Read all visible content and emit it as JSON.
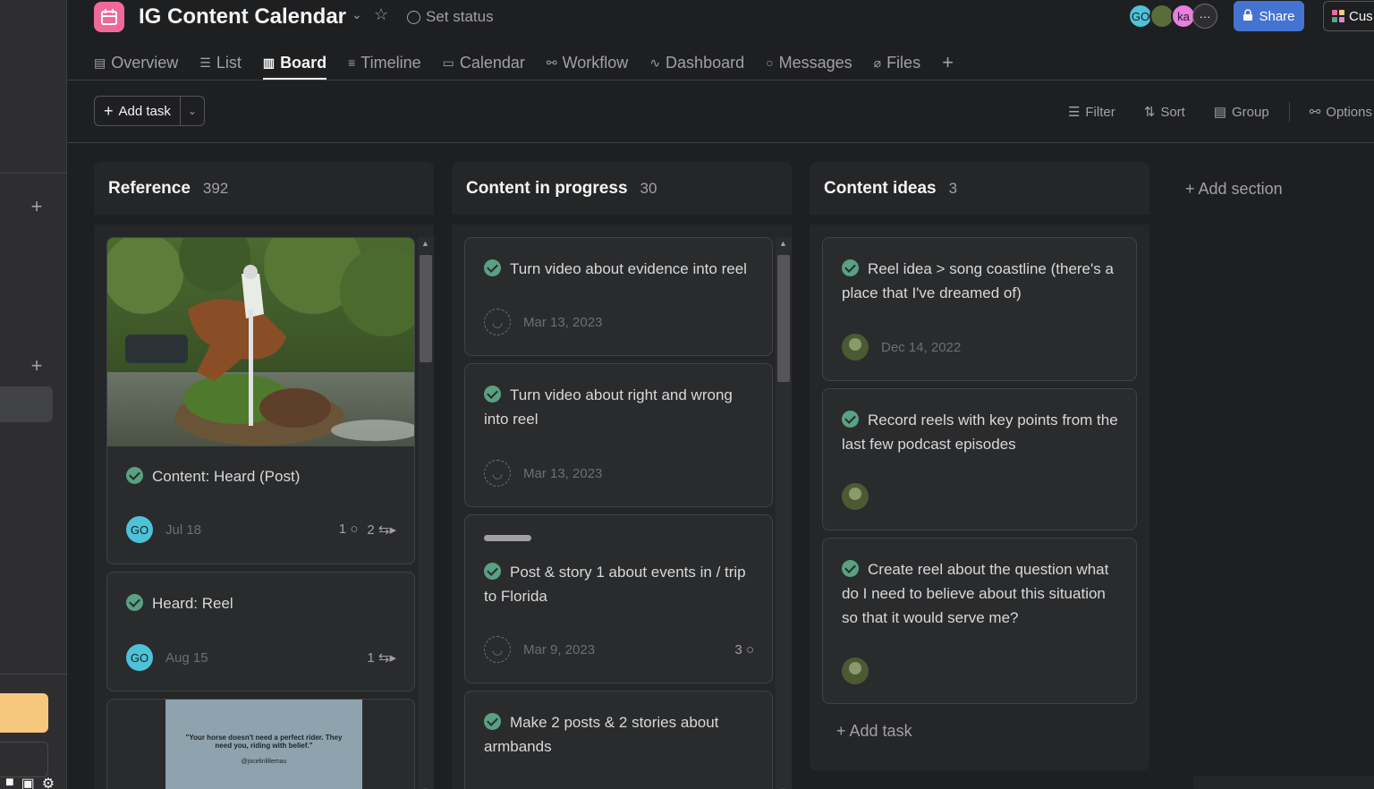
{
  "project": {
    "title": "IG Content Calendar",
    "set_status": "Set status",
    "icon_color": "#f06a99"
  },
  "header": {
    "avatars": [
      "GO",
      "",
      "ka",
      "···"
    ],
    "share_label": "Share",
    "customize_label": "Cus"
  },
  "tabs": [
    {
      "label": "Overview",
      "icon": "overview-icon"
    },
    {
      "label": "List",
      "icon": "list-icon"
    },
    {
      "label": "Board",
      "icon": "board-icon",
      "active": true
    },
    {
      "label": "Timeline",
      "icon": "timeline-icon"
    },
    {
      "label": "Calendar",
      "icon": "calendar-icon"
    },
    {
      "label": "Workflow",
      "icon": "workflow-icon"
    },
    {
      "label": "Dashboard",
      "icon": "dashboard-icon"
    },
    {
      "label": "Messages",
      "icon": "messages-icon"
    },
    {
      "label": "Files",
      "icon": "files-icon"
    }
  ],
  "toolbar": {
    "add_task": "Add task",
    "filter": "Filter",
    "sort": "Sort",
    "group": "Group",
    "options": "Options"
  },
  "columns": [
    {
      "title": "Reference",
      "count": "392",
      "cards": [
        {
          "title": "Content: Heard (Post)",
          "assignee": "GO",
          "date": "Jul 18",
          "comments": "1",
          "subtasks": "2"
        },
        {
          "title": "Heard: Reel",
          "assignee": "GO",
          "date": "Aug 15",
          "subtasks": "1"
        },
        {
          "title": "",
          "cover_text": "\"Your horse doesn't need a perfect rider. They need you, riding with belief.\"",
          "cover_handle": "@jocelinlillemau"
        }
      ]
    },
    {
      "title": "Content in progress",
      "count": "30",
      "cards": [
        {
          "title": "Turn video about evidence into reel",
          "date": "Mar 13, 2023"
        },
        {
          "title": "Turn video about right and wrong into reel",
          "date": "Mar 13, 2023"
        },
        {
          "title": "Post & story 1 about events in / trip to Florida",
          "date": "Mar 9, 2023",
          "comments": "3"
        },
        {
          "title": "Make 2 posts & 2 stories about armbands"
        }
      ]
    },
    {
      "title": "Content ideas",
      "count": "3",
      "cards": [
        {
          "title": "Reel idea > song coastline (there's a place that I've dreamed of)",
          "date": "Dec 14, 2022"
        },
        {
          "title": "Record reels with key points from the last few podcast episodes"
        },
        {
          "title": "Create reel about the question what do I need to believe about this situation so that it would serve me?"
        }
      ],
      "add_task": "Add task"
    }
  ],
  "add_section": "Add section",
  "colors": {
    "background": "#1e1f21",
    "column": "#252628",
    "card": "#2a2b2d",
    "accent_blue": "#4573d2",
    "check_green": "#58a182",
    "go_avatar": "#4ec2d8"
  }
}
